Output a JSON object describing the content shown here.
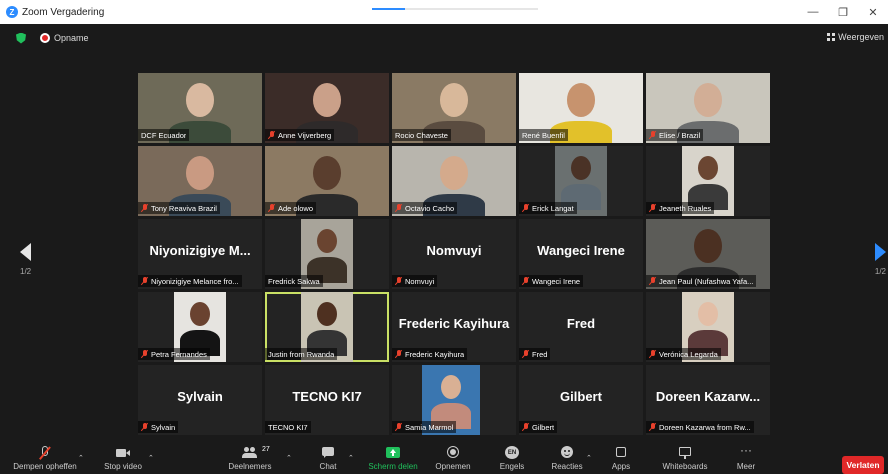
{
  "window": {
    "title": "Zoom Vergadering",
    "controls": [
      "—",
      "❐",
      "✕"
    ],
    "progress": 0.2
  },
  "status": {
    "recording_label": "Opname",
    "view_label": "Weergeven"
  },
  "pagination": {
    "left": "1/2",
    "right": "1/2"
  },
  "tiles": [
    {
      "name": "DCF Ecuador",
      "big": "",
      "video": true,
      "muted": false
    },
    {
      "name": "Anne Vijverberg",
      "big": "",
      "video": true,
      "muted": true
    },
    {
      "name": "Rocio Chaveste",
      "big": "",
      "video": true,
      "muted": false
    },
    {
      "name": "René Buenfil",
      "big": "",
      "video": true,
      "muted": false
    },
    {
      "name": "Elise / Brazil",
      "big": "",
      "video": true,
      "muted": true
    },
    {
      "name": "Tony Reaviva Brazil",
      "big": "",
      "video": true,
      "muted": true
    },
    {
      "name": "Ade olowo",
      "big": "",
      "video": true,
      "muted": true
    },
    {
      "name": "Octavio Cacho",
      "big": "",
      "video": true,
      "muted": true
    },
    {
      "name": "Erick Langat",
      "big": "",
      "video": true,
      "muted": true
    },
    {
      "name": "Jeaneth Ruales",
      "big": "",
      "video": true,
      "muted": true
    },
    {
      "name": "Niyonizigiye Melance fro...",
      "big": "Niyonizigiye M...",
      "video": false,
      "muted": true
    },
    {
      "name": "Fredrick Sakwa",
      "big": "",
      "video": true,
      "muted": false
    },
    {
      "name": "Nomvuyi",
      "big": "Nomvuyi",
      "video": false,
      "muted": true
    },
    {
      "name": "Wangeci Irene",
      "big": "Wangeci Irene",
      "video": false,
      "muted": true
    },
    {
      "name": "Jean Paul (Nufashwa Yafa...",
      "big": "",
      "video": true,
      "muted": true
    },
    {
      "name": "Petra Fernandes",
      "big": "",
      "video": true,
      "muted": true
    },
    {
      "name": "Justin from Rwanda",
      "big": "",
      "video": true,
      "muted": false
    },
    {
      "name": "Frederic Kayihura",
      "big": "Frederic Kayihura",
      "video": false,
      "muted": true
    },
    {
      "name": "Fred",
      "big": "Fred",
      "video": false,
      "muted": true
    },
    {
      "name": "Verónica Legarda",
      "big": "",
      "video": true,
      "muted": true
    },
    {
      "name": "Sylvain",
      "big": "Sylvain",
      "video": false,
      "muted": true
    },
    {
      "name": "TECNO KI7",
      "big": "TECNO KI7",
      "video": false,
      "muted": false
    },
    {
      "name": "Samia Marmol",
      "big": "",
      "video": true,
      "muted": true
    },
    {
      "name": "Gilbert",
      "big": "Gilbert",
      "video": false,
      "muted": true
    },
    {
      "name": "Doreen Kazarwa from Rw...",
      "big": "Doreen Kazarw...",
      "video": false,
      "muted": true
    }
  ],
  "toolbar": {
    "mute_label": "Dempen opheffen",
    "video_label": "Stop video",
    "participants_label": "Deelnemers",
    "participants_count": "27",
    "chat_label": "Chat",
    "share_label": "Scherm delen",
    "record_label": "Opnemen",
    "language_label": "Engels",
    "language_code": "EN",
    "reactions_label": "Reacties",
    "apps_label": "Apps",
    "whiteboard_label": "Whiteboards",
    "more_label": "Meer",
    "leave_label": "Verlaten"
  },
  "colors": {
    "accent": "#2d8cff",
    "active_speaker": "#c9e065",
    "mute": "#e8412c",
    "leave": "#e02828",
    "share": "#20c05c"
  }
}
